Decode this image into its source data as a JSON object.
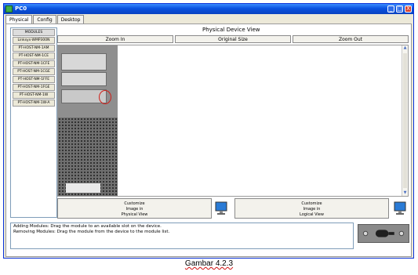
{
  "window": {
    "title": "PC0",
    "controls": {
      "minimize": "_",
      "maximize": "□",
      "close": "X"
    }
  },
  "tabs": [
    {
      "label": "Physical",
      "active": true
    },
    {
      "label": "Config",
      "active": false
    },
    {
      "label": "Desktop",
      "active": false
    }
  ],
  "modules": {
    "header": "MODULES",
    "items": [
      "Linksys-WMP300N",
      "PT-HOST-NM-1AM",
      "PT-HOST-NM-1CE",
      "PT-HOST-NM-1CFE",
      "PT-HOST-NM-1CGE",
      "PT-HOST-NM-1FFE",
      "PT-HOST-NM-1FGE",
      "PT-HOST-NM-1W",
      "PT-HOST-NM-1W-A"
    ]
  },
  "physical_view": {
    "title": "Physical Device View",
    "zoom_in": "Zoom In",
    "original_size": "Original Size",
    "zoom_out": "Zoom Out"
  },
  "customize": {
    "physical": [
      "Customize",
      "Image in",
      "Physical View"
    ],
    "logical": [
      "Customize",
      "Image in",
      "Logical View"
    ]
  },
  "description": {
    "line1": "Adding Modules: Drag the module to an available slot on the device.",
    "line2": "Removing Modules: Drag the module from the device to the module list."
  },
  "caption": "Gambar 4.2.3",
  "colors": {
    "titlebar": "#0a52e0",
    "window_bg": "#ece9d8",
    "annotation_red": "#d0201a"
  }
}
